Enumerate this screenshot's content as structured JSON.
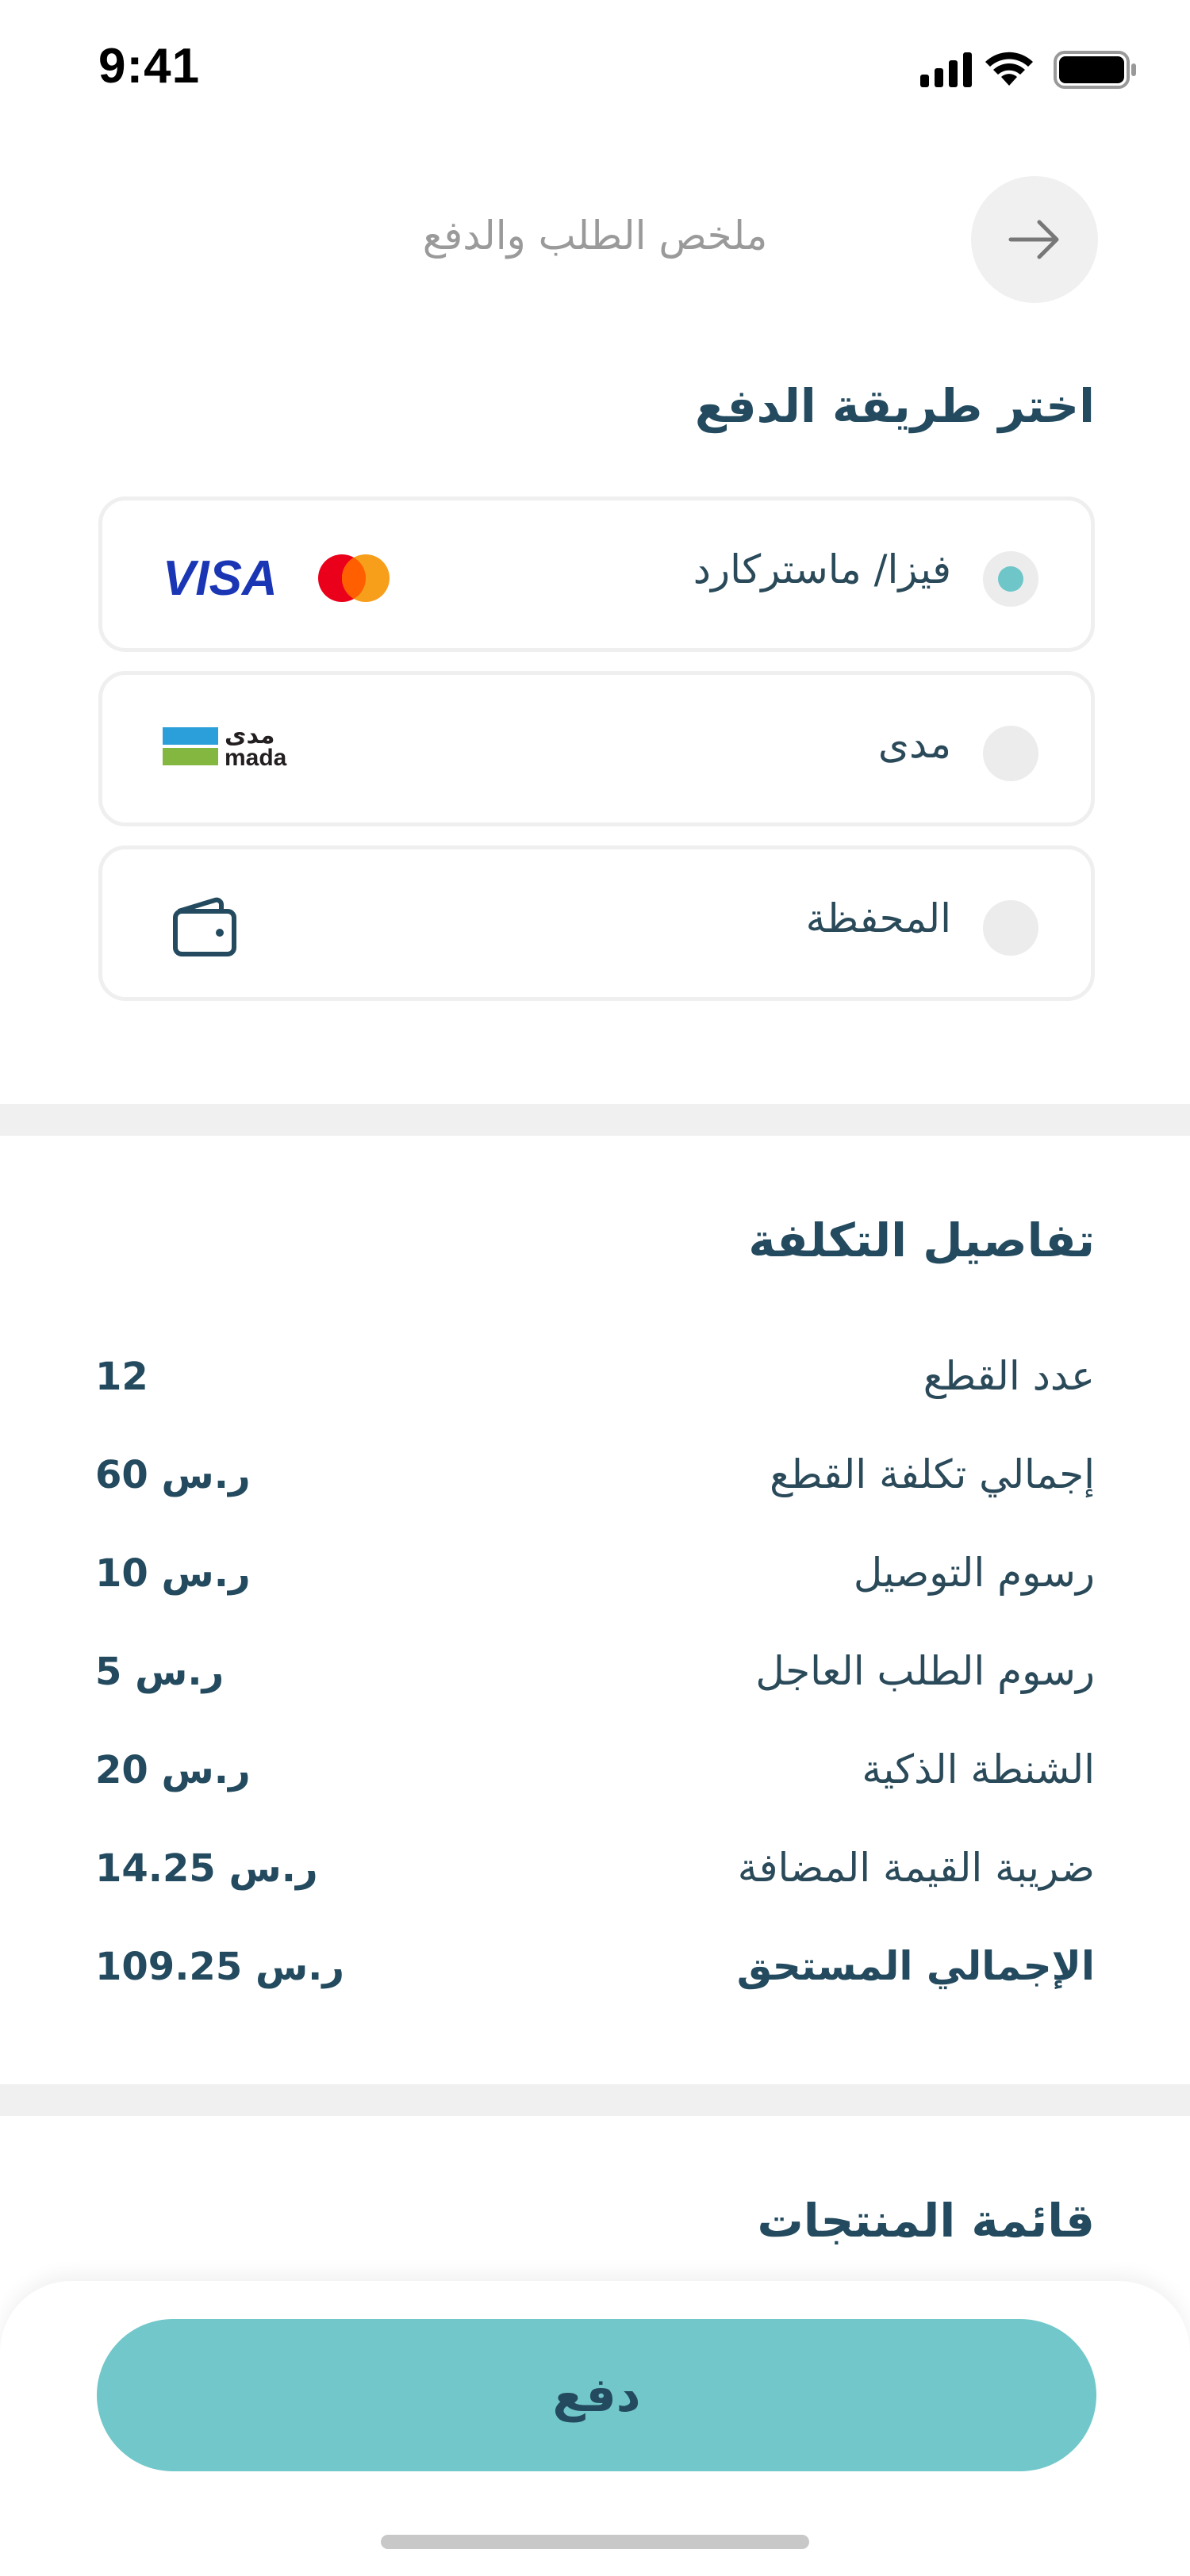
{
  "status_bar": {
    "time": "9:41"
  },
  "header": {
    "title": "ملخص الطلب والدفع",
    "back_icon": "arrow-right-icon"
  },
  "payment": {
    "section_title": "اختر طريقة الدفع",
    "options": [
      {
        "label": "فيزا/ ماستركارد",
        "selected": true,
        "logo": "visa-mastercard-logo",
        "logo_text": "VISA"
      },
      {
        "label": "مدى",
        "selected": false,
        "logo": "mada-logo",
        "logo_text_ar": "مدى",
        "logo_text_en": "mada"
      },
      {
        "label": "المحفظة",
        "selected": false,
        "logo": "wallet-icon"
      }
    ]
  },
  "cost": {
    "section_title": "تفاصيل التكلفة",
    "rows": [
      {
        "label": "عدد القطع",
        "value": "12"
      },
      {
        "label": "إجمالي تكلفة القطع",
        "value": "60 ر.س"
      },
      {
        "label": "رسوم التوصيل",
        "value": "10 ر.س"
      },
      {
        "label": "رسوم الطلب العاجل",
        "value": "5 ر.س"
      },
      {
        "label": "الشنطة الذكية",
        "value": "20 ر.س"
      },
      {
        "label": "ضريبة القيمة المضافة",
        "value": "14.25 ر.س"
      },
      {
        "label": "الإجمالي المستحق",
        "value": "109.25 ر.س"
      }
    ]
  },
  "products": {
    "section_title": "قائمة المنتجات"
  },
  "footer": {
    "pay_button_label": "دفع"
  },
  "colors": {
    "accent": "#72c7ca",
    "text_dark": "#234a5e",
    "muted": "#9a9a9a",
    "divider": "#f0f0f0"
  }
}
